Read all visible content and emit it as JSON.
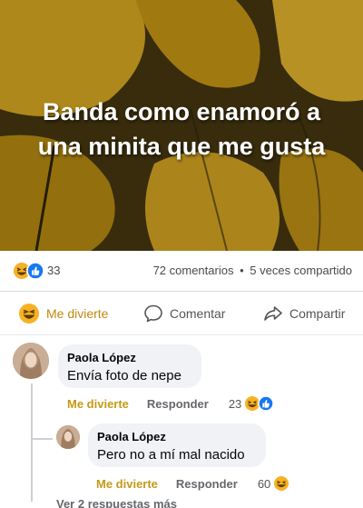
{
  "post": {
    "caption_line1": "Banda como enamoró a",
    "caption_line2": "una minita que me gusta"
  },
  "stats": {
    "reaction_count": "33",
    "comments": "72 comentarios",
    "dot": "•",
    "shares": "5 veces compartido"
  },
  "actions": {
    "reaction_label": "Me divierte",
    "comment_label": "Comentar",
    "share_label": "Compartir"
  },
  "comments": [
    {
      "author": "Paola López",
      "text": "Envía foto de nepe",
      "reaction_label": "Me divierte",
      "reply_label": "Responder",
      "reaction_count": "23"
    },
    {
      "author": "Paola López",
      "text": "Pero no a mí mal nacido",
      "reaction_label": "Me divierte",
      "reply_label": "Responder",
      "reaction_count": "60"
    }
  ],
  "more_replies": "Ver 2 respuestas más",
  "colors": {
    "haha": "#f7b125",
    "like": "#1877f2",
    "accent_reaction_text": "#c39a17"
  }
}
